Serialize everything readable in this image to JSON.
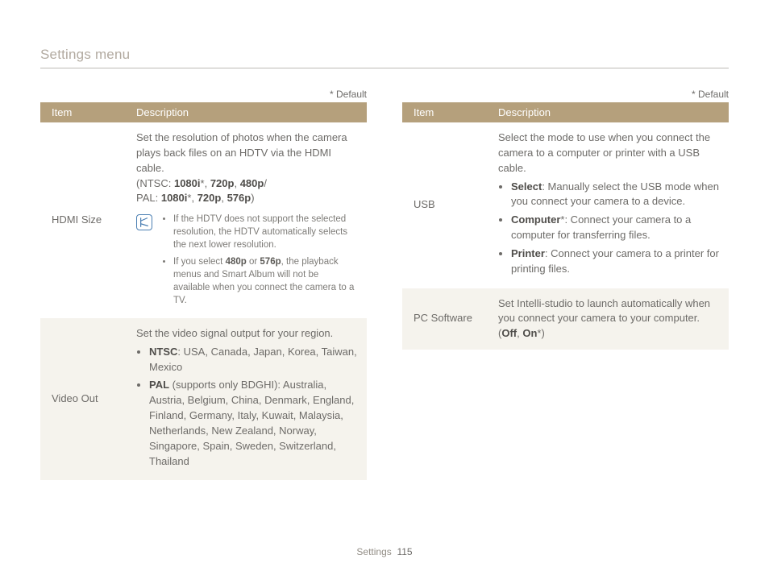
{
  "title": "Settings menu",
  "default_note": "* Default",
  "footer": {
    "section": "Settings",
    "page": "115"
  },
  "left": {
    "headers": {
      "item": "Item",
      "desc": "Description"
    },
    "rows": [
      {
        "item": "HDMI Size",
        "lead": "Set the resolution of photos when the camera plays back files on an HDTV via the HDMI cable.",
        "res_ntsc_label": "(NTSC:",
        "res_ntsc_1": "1080i",
        "res_ntsc_2": "720p",
        "res_ntsc_3": "480p",
        "res_pal_label": "PAL:",
        "res_pal_1": "1080i",
        "res_pal_2": "720p",
        "res_pal_3": "576p",
        "notes": [
          {
            "pre": "If the HDTV does not support the selected resolution, the HDTV automatically selects the next lower resolution."
          },
          {
            "pre": "If you select ",
            "b1": "480p",
            "mid": " or ",
            "b2": "576p",
            "post": ", the playback menus and Smart Album will not be available when you connect the camera to a TV."
          }
        ]
      },
      {
        "item": "Video Out",
        "lead": "Set the video signal output for your region.",
        "bullets": [
          {
            "b": "NTSC",
            "text": ": USA, Canada, Japan, Korea, Taiwan, Mexico"
          },
          {
            "b": "PAL",
            "text": " (supports only BDGHI): Australia, Austria, Belgium, China, Denmark, England, Finland, Germany, Italy, Kuwait, Malaysia, Netherlands, New Zealand, Norway, Singapore, Spain, Sweden, Switzerland, Thailand"
          }
        ]
      }
    ]
  },
  "right": {
    "headers": {
      "item": "Item",
      "desc": "Description"
    },
    "rows": [
      {
        "item": "USB",
        "lead": "Select the mode to use when you connect the camera to a computer or printer with a USB cable.",
        "bullets": [
          {
            "b": "Select",
            "text": ": Manually select the USB mode when you connect your camera to a device."
          },
          {
            "b": "Computer",
            "star": "*",
            "text": ": Connect your camera to a computer for transferring files."
          },
          {
            "b": "Printer",
            "text": ": Connect your camera to a printer for printing files."
          }
        ]
      },
      {
        "item": "PC Software",
        "lead_pre": "Set Intelli-studio to launch automatically when you connect your camera to your computer. (",
        "b1": "Off",
        "sep": ", ",
        "b2": "On",
        "lead_post": ")"
      }
    ]
  }
}
